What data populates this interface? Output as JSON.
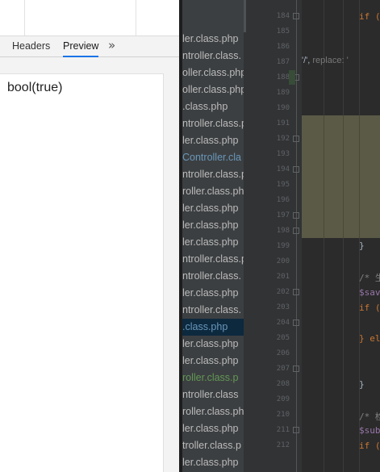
{
  "devtools": {
    "tabs": [
      {
        "label": "Headers",
        "active": false
      },
      {
        "label": "Preview",
        "active": true
      }
    ],
    "more_icon": "double-chevron-right-icon",
    "more_glyph": "»",
    "preview_text": "bool(true)",
    "accent": "#1a73e8"
  },
  "files": [
    {
      "text": "ler.class.php",
      "color": "#bbbbbb",
      "selected": false
    },
    {
      "text": "ntroller.class.",
      "color": "#bbbbbb",
      "selected": false
    },
    {
      "text": "oller.class.php",
      "color": "#bbbbbb",
      "selected": false
    },
    {
      "text": "oller.class.php",
      "color": "#bbbbbb",
      "selected": false
    },
    {
      "text": ".class.php",
      "color": "#bbbbbb",
      "selected": false
    },
    {
      "text": "ntroller.class.p",
      "color": "#bbbbbb",
      "selected": false
    },
    {
      "text": "ler.class.php",
      "color": "#bbbbbb",
      "selected": false
    },
    {
      "text": "Controller.cla",
      "color": "#6897bb",
      "selected": false
    },
    {
      "text": "ntroller.class.p",
      "color": "#bbbbbb",
      "selected": false
    },
    {
      "text": "roller.class.ph",
      "color": "#bbbbbb",
      "selected": false
    },
    {
      "text": "ler.class.php",
      "color": "#bbbbbb",
      "selected": false
    },
    {
      "text": "ler.class.php",
      "color": "#bbbbbb",
      "selected": false
    },
    {
      "text": "ler.class.php",
      "color": "#bbbbbb",
      "selected": false
    },
    {
      "text": "ntroller.class.p",
      "color": "#bbbbbb",
      "selected": false
    },
    {
      "text": "ntroller.class.",
      "color": "#bbbbbb",
      "selected": false
    },
    {
      "text": "ler.class.php",
      "color": "#bbbbbb",
      "selected": false
    },
    {
      "text": "ntroller.class.",
      "color": "#bbbbbb",
      "selected": false
    },
    {
      "text": ".class.php",
      "color": "#6897bb",
      "selected": true
    },
    {
      "text": "ler.class.php",
      "color": "#bbbbbb",
      "selected": false
    },
    {
      "text": "ler.class.php",
      "color": "#bbbbbb",
      "selected": false
    },
    {
      "text": "roller.class.p",
      "color": "#629755",
      "selected": false
    },
    {
      "text": "ntroller.class",
      "color": "#bbbbbb",
      "selected": false
    },
    {
      "text": "roller.class.ph",
      "color": "#bbbbbb",
      "selected": false
    },
    {
      "text": "ler.class.php",
      "color": "#bbbbbb",
      "selected": false
    },
    {
      "text": "troller.class.p",
      "color": "#bbbbbb",
      "selected": false
    },
    {
      "text": "ler.class.php",
      "color": "#bbbbbb",
      "selected": false
    }
  ],
  "line_numbers": [
    "184",
    "185",
    "186",
    "187",
    "188",
    "189",
    "190",
    "191",
    "192",
    "193",
    "194",
    "195",
    "196",
    "197",
    "198",
    "199",
    "200",
    "201",
    "202",
    "203",
    "204",
    "205",
    "206",
    "207",
    "208",
    "209",
    "210",
    "211",
    "212"
  ],
  "code": {
    "if_kw": "if (",
    "hint_text": "'/',",
    "hint_label": "replace: '",
    "brace_close": "}",
    "comment1": "/* 生",
    "var_sav": "$sav",
    "if2": "if (",
    "else": "} el",
    "brace2": "}",
    "comment2": "/* 检",
    "var_sub": "$subj",
    "if3": "if ("
  },
  "colors": {
    "editor_bg": "#2b2b2b",
    "keyword": "#cc7832",
    "comment": "#808080",
    "variable": "#9876aa",
    "highlight": "#5a5a47"
  }
}
